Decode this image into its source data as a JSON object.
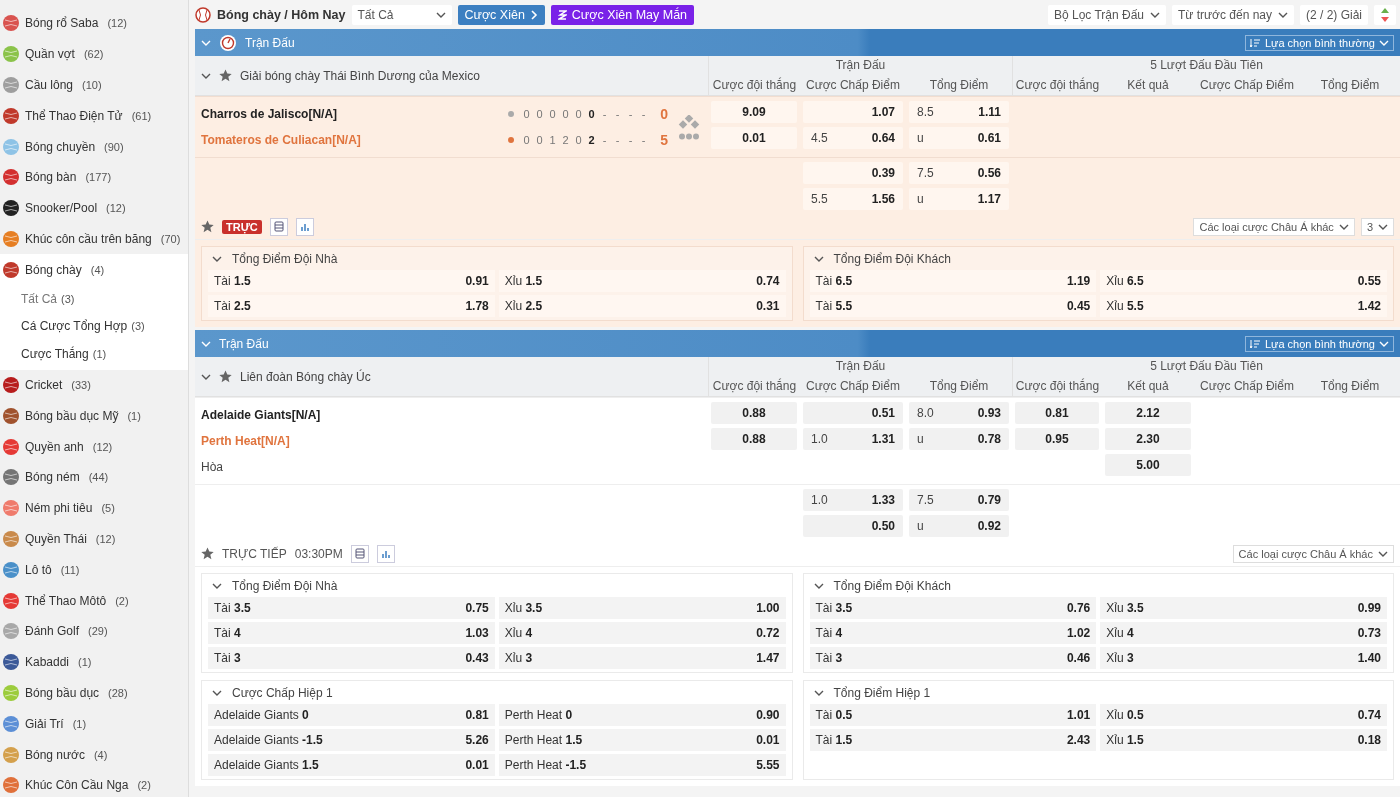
{
  "sidebar": {
    "items": [
      {
        "label": "Bóng rổ Saba",
        "count": "(12)",
        "color": "#d9534f",
        "selected": false
      },
      {
        "label": "Quần vợt",
        "count": "(62)",
        "color": "#8bc34a",
        "selected": false
      },
      {
        "label": "Cầu lông",
        "count": "(10)",
        "color": "#9e9e9e",
        "selected": false
      },
      {
        "label": "Thể Thao Điện Tử",
        "count": "(61)",
        "color": "#c0392b",
        "selected": false
      },
      {
        "label": "Bóng chuyền",
        "count": "(90)",
        "color": "#8ec3e6",
        "selected": false
      },
      {
        "label": "Bóng bàn",
        "count": "(177)",
        "color": "#d32f2f",
        "selected": false
      },
      {
        "label": "Snooker/Pool",
        "count": "(12)",
        "color": "#222222",
        "selected": false
      },
      {
        "label": "Khúc côn cầu trên băng",
        "count": "(70)",
        "color": "#e67e22",
        "selected": false
      },
      {
        "label": "Bóng chày",
        "count": "(4)",
        "color": "#c0392b",
        "selected": true,
        "children": [
          {
            "label": "Tất Cả",
            "count": "(3)",
            "selected": true
          },
          {
            "label": "Cá Cược Tổng Hợp",
            "count": "(3)",
            "selected": false
          },
          {
            "label": "Cược Thắng",
            "count": "(1)",
            "selected": false
          }
        ]
      },
      {
        "label": "Cricket",
        "count": "(33)",
        "color": "#b71c1c",
        "selected": false
      },
      {
        "label": "Bóng bầu dục Mỹ",
        "count": "(1)",
        "color": "#a0522d",
        "selected": false
      },
      {
        "label": "Quyền anh",
        "count": "(12)",
        "color": "#e53935",
        "selected": false
      },
      {
        "label": "Bóng ném",
        "count": "(44)",
        "color": "#757575",
        "selected": false
      },
      {
        "label": "Ném phi tiêu",
        "count": "(5)",
        "color": "#ef7b6c",
        "selected": false
      },
      {
        "label": "Quyền Thái",
        "count": "(12)",
        "color": "#c98a4b",
        "selected": false
      },
      {
        "label": "Lô tô",
        "count": "(11)",
        "color": "#4a90c9",
        "selected": false
      },
      {
        "label": "Thể Thao Môtô",
        "count": "(2)",
        "color": "#e53935",
        "selected": false
      },
      {
        "label": "Đánh Golf",
        "count": "(29)",
        "color": "#a8a8a8",
        "selected": false
      },
      {
        "label": "Kabaddi",
        "count": "(1)",
        "color": "#3b5998",
        "selected": false
      },
      {
        "label": "Bóng bầu dục",
        "count": "(28)",
        "color": "#9ccc3c",
        "selected": false
      },
      {
        "label": "Giải Trí",
        "count": "(1)",
        "color": "#5c8fd6",
        "selected": false
      },
      {
        "label": "Bóng nước",
        "count": "(4)",
        "color": "#d4a04c",
        "selected": false
      },
      {
        "label": "Khúc Côn Cầu Nga",
        "count": "(2)",
        "color": "#e0703a",
        "selected": false
      }
    ]
  },
  "top_bar": {
    "title": "Bóng chày / Hôm Nay",
    "controls": [
      {
        "kind": "dropdown",
        "label": "Tất Cả"
      },
      {
        "kind": "parlay",
        "label": "Cược Xiên"
      },
      {
        "kind": "lucky",
        "label": "Cược Xiên May Mắn"
      }
    ],
    "filters": [
      {
        "kind": "dropdown",
        "label": "Bộ Lọc Trận Đấu"
      },
      {
        "kind": "dropdown",
        "label": "Từ trước đến nay"
      },
      {
        "kind": "button",
        "label": "(2 / 2) Giải"
      }
    ]
  },
  "sections": [
    {
      "title": "Trận Đấu",
      "live": true,
      "sort_label": "Lựa chọn bình thường",
      "league": "Giải bóng chày Thái Bình Dương của Mexico",
      "groups": [
        {
          "title": "Trận Đấu",
          "columns": [
            "Cược đội thắng",
            "Cược Chấp Điểm",
            "Tổng Điểm"
          ]
        },
        {
          "title": "5 Lượt Đấu Đầu Tiên",
          "columns": [
            "Cược đội thắng",
            "Kết quả",
            "Cược Chấp Điểm",
            "Tổng Điểm"
          ]
        }
      ],
      "teams": [
        {
          "name": "Charros de Jalisco[N/A]",
          "kind": "home",
          "batting": false,
          "innings": [
            {
              "score": "0",
              "current": false
            },
            {
              "score": "0",
              "current": false
            },
            {
              "score": "0",
              "current": false
            },
            {
              "score": "0",
              "current": false
            },
            {
              "score": "0",
              "current": false
            },
            {
              "score": "0",
              "current": true
            },
            {
              "score": "-",
              "current": false
            },
            {
              "score": "-",
              "current": false
            },
            {
              "score": "-",
              "current": false
            },
            {
              "score": "-",
              "current": false
            }
          ],
          "total": "0"
        },
        {
          "name": "Tomateros de Culiacan[N/A]",
          "kind": "away",
          "batting": true,
          "innings": [
            {
              "score": "0",
              "current": false
            },
            {
              "score": "0",
              "current": false
            },
            {
              "score": "1",
              "current": false
            },
            {
              "score": "2",
              "current": false
            },
            {
              "score": "0",
              "current": false
            },
            {
              "score": "2",
              "current": true
            },
            {
              "score": "-",
              "current": false
            },
            {
              "score": "-",
              "current": false
            },
            {
              "score": "-",
              "current": false
            },
            {
              "score": "-",
              "current": false
            }
          ],
          "total": "5"
        }
      ],
      "odds_blocks": [
        [
          {
            "ft_win": {
              "odds": "9.09"
            },
            "ft_handicap": {
              "odds": "1.07"
            },
            "ft_total": {
              "line": "8.5",
              "odds": "1.11"
            }
          },
          {
            "ft_win": {
              "odds": "0.01"
            },
            "ft_handicap": {
              "line": "4.5",
              "odds": "0.64"
            },
            "ft_total": {
              "line": "u",
              "odds": "0.61"
            }
          }
        ],
        [
          {
            "ft_handicap": {
              "odds": "0.39"
            },
            "ft_total": {
              "line": "7.5",
              "odds": "0.56"
            }
          },
          {
            "ft_handicap": {
              "line": "5.5",
              "odds": "1.56"
            },
            "ft_total": {
              "line": "u",
              "odds": "1.17"
            }
          }
        ]
      ],
      "live_bar": {
        "label": "TRỰC",
        "kind": "badge",
        "dropdowns": [
          "Các loại cược Châu Á khác",
          "3"
        ]
      },
      "markets": [
        {
          "title": "Tổng Điểm Đội Nhà",
          "rows": [
            [
              {
                "name": "Tài",
                "line": "1.5",
                "odds": "0.91"
              },
              {
                "name": "Xỉu",
                "line": "1.5",
                "odds": "0.74"
              }
            ],
            [
              {
                "name": "Tài",
                "line": "2.5",
                "odds": "1.78"
              },
              {
                "name": "Xỉu",
                "line": "2.5",
                "odds": "0.31"
              }
            ]
          ]
        },
        {
          "title": "Tổng Điểm Đội Khách",
          "rows": [
            [
              {
                "name": "Tài",
                "line": "6.5",
                "odds": "1.19"
              },
              {
                "name": "Xỉu",
                "line": "6.5",
                "odds": "0.55"
              }
            ],
            [
              {
                "name": "Tài",
                "line": "5.5",
                "odds": "0.45"
              },
              {
                "name": "Xỉu",
                "line": "5.5",
                "odds": "1.42"
              }
            ]
          ]
        }
      ]
    },
    {
      "title": "Trận Đấu",
      "live": false,
      "sort_label": "Lựa chọn bình thường",
      "league": "Liên đoàn Bóng chày Úc",
      "groups": [
        {
          "title": "Trận Đấu",
          "columns": [
            "Cược đội thắng",
            "Cược Chấp Điểm",
            "Tổng Điểm"
          ]
        },
        {
          "title": "5 Lượt Đấu Đầu Tiên",
          "columns": [
            "Cược đội thắng",
            "Kết quả",
            "Cược Chấp Điểm",
            "Tổng Điểm"
          ]
        }
      ],
      "teams": [
        {
          "name": "Adelaide Giants[N/A]",
          "kind": "home"
        },
        {
          "name": "Perth Heat[N/A]",
          "kind": "away"
        },
        {
          "name": "Hòa",
          "kind": "draw"
        }
      ],
      "odds_blocks": [
        [
          {
            "ft_win": {
              "odds": "0.88"
            },
            "ft_handicap": {
              "odds": "0.51"
            },
            "ft_total": {
              "line": "8.0",
              "odds": "0.93"
            },
            "h5_win": {
              "odds": "0.81"
            },
            "h5_result": {
              "odds": "2.12"
            }
          },
          {
            "ft_win": {
              "odds": "0.88"
            },
            "ft_handicap": {
              "line": "1.0",
              "odds": "1.31"
            },
            "ft_total": {
              "line": "u",
              "odds": "0.78"
            },
            "h5_win": {
              "odds": "0.95"
            },
            "h5_result": {
              "odds": "2.30"
            }
          },
          {
            "h5_result": {
              "odds": "5.00"
            }
          }
        ],
        [
          {
            "ft_handicap": {
              "line": "1.0",
              "odds": "1.33"
            },
            "ft_total": {
              "line": "7.5",
              "odds": "0.79"
            }
          },
          {
            "ft_handicap": {
              "odds": "0.50"
            },
            "ft_total": {
              "line": "u",
              "odds": "0.92"
            }
          }
        ]
      ],
      "live_bar": {
        "label": "TRỰC TIẾP",
        "kind": "text",
        "time": "03:30PM",
        "dropdowns": [
          "Các loại cược Châu Á khác"
        ]
      },
      "markets": [
        {
          "title": "Tổng Điểm Đội Nhà",
          "rows": [
            [
              {
                "name": "Tài",
                "line": "3.5",
                "odds": "0.75"
              },
              {
                "name": "Xỉu",
                "line": "3.5",
                "odds": "1.00"
              }
            ],
            [
              {
                "name": "Tài",
                "line": "4",
                "odds": "1.03"
              },
              {
                "name": "Xỉu",
                "line": "4",
                "odds": "0.72"
              }
            ],
            [
              {
                "name": "Tài",
                "line": "3",
                "odds": "0.43"
              },
              {
                "name": "Xỉu",
                "line": "3",
                "odds": "1.47"
              }
            ]
          ]
        },
        {
          "title": "Tổng Điểm Đội Khách",
          "rows": [
            [
              {
                "name": "Tài",
                "line": "3.5",
                "odds": "0.76"
              },
              {
                "name": "Xỉu",
                "line": "3.5",
                "odds": "0.99"
              }
            ],
            [
              {
                "name": "Tài",
                "line": "4",
                "odds": "1.02"
              },
              {
                "name": "Xỉu",
                "line": "4",
                "odds": "0.73"
              }
            ],
            [
              {
                "name": "Tài",
                "line": "3",
                "odds": "0.46"
              },
              {
                "name": "Xỉu",
                "line": "3",
                "odds": "1.40"
              }
            ]
          ]
        },
        {
          "title": "Cược Chấp Hiệp 1",
          "rows": [
            [
              {
                "name": "Adelaide Giants",
                "line": "0",
                "odds": "0.81"
              },
              {
                "name": "Perth Heat",
                "line": "0",
                "odds": "0.90"
              }
            ],
            [
              {
                "name": "Adelaide Giants",
                "line": "-1.5",
                "odds": "5.26"
              },
              {
                "name": "Perth Heat",
                "line": "1.5",
                "odds": "0.01"
              }
            ],
            [
              {
                "name": "Adelaide Giants",
                "line": "1.5",
                "odds": "0.01"
              },
              {
                "name": "Perth Heat",
                "line": "-1.5",
                "odds": "5.55"
              }
            ]
          ]
        },
        {
          "title": "Tổng Điểm Hiệp 1",
          "rows": [
            [
              {
                "name": "Tài",
                "line": "0.5",
                "odds": "1.01"
              },
              {
                "name": "Xỉu",
                "line": "0.5",
                "odds": "0.74"
              }
            ],
            [
              {
                "name": "Tài",
                "line": "1.5",
                "odds": "2.43"
              },
              {
                "name": "Xỉu",
                "line": "1.5",
                "odds": "0.18"
              }
            ]
          ]
        }
      ]
    }
  ]
}
